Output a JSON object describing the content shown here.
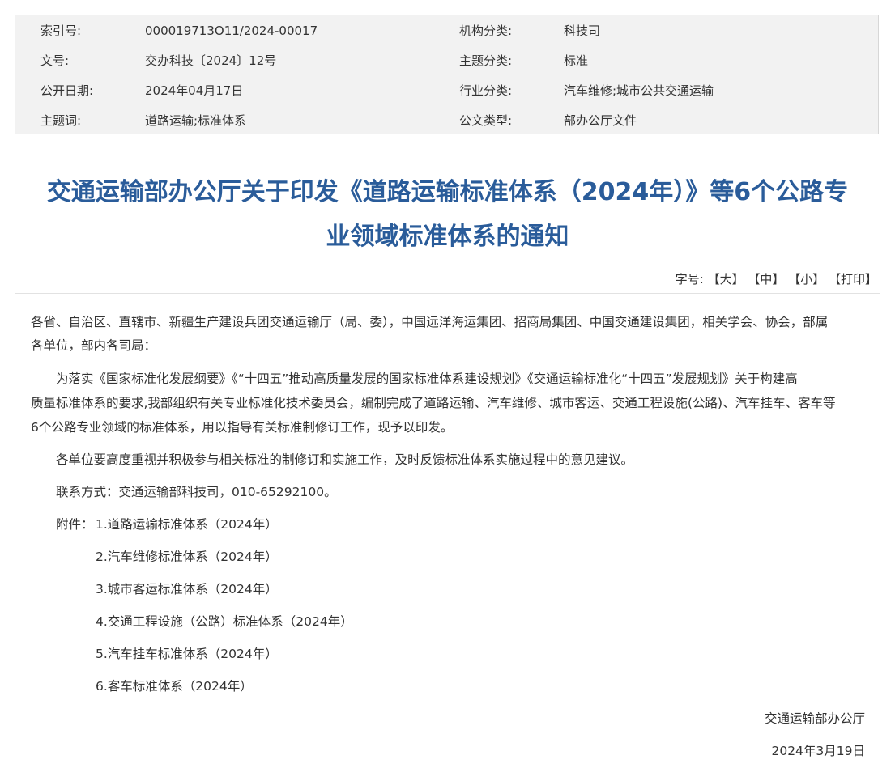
{
  "meta": {
    "index_label": "索引号:",
    "index_value": "000019713O11/2024-00017",
    "org_label": "机构分类:",
    "org_value": "科技司",
    "doc_label": "文号:",
    "doc_value": "交办科技〔2024〕12号",
    "topic_cat_label": "主题分类:",
    "topic_cat_value": "标准",
    "date_label": "公开日期:",
    "date_value": "2024年04月17日",
    "industry_label": "行业分类:",
    "industry_value": "汽车维修;城市公共交通运输",
    "keywords_label": "主题词:",
    "keywords_value": "道路运输;标准体系",
    "doctype_label": "公文类型:",
    "doctype_value": "部办公厅文件"
  },
  "title": {
    "line1": "交通运输部办公厅关于印发《道路运输标准体系（2024年）》等6个公路专",
    "line2": "业领域标准体系的通知"
  },
  "fontsize": {
    "label": "字号:",
    "large": "【大】",
    "medium": "【中】",
    "small": "【小】",
    "print": "【打印】"
  },
  "body": {
    "addressee1": "各省、自治区、直辖市、新疆生产建设兵团交通运输厅（局、委），中国远洋海运集团、招商局集团、中国交通建设集团，相关学会、协会，部属",
    "addressee2": "各单位，部内各司局：",
    "p1_l1": "为落实《国家标准化发展纲要》《“十四五”推动高质量发展的国家标准体系建设规划》《交通运输标准化“十四五”发展规划》关于构建高",
    "p1_l2": "质量标准体系的要求,我部组织有关专业标准化技术委员会，编制完成了道路运输、汽车维修、城市客运、交通工程设施(公路)、汽车挂车、客车等",
    "p1_l3": "6个公路专业领域的标准体系，用以指导有关标准制修订工作，现予以印发。",
    "p2": "各单位要高度重视并积极参与相关标准的制修订和实施工作，及时反馈标准体系实施过程中的意见建议。",
    "contact": "联系方式：交通运输部科技司，010-65292100。",
    "attachments_label": "附件：",
    "attachments": [
      "1.道路运输标准体系（2024年）",
      "2.汽车维修标准体系（2024年）",
      "3.城市客运标准体系（2024年）",
      "4.交通工程设施（公路）标准体系（2024年）",
      "5.汽车挂车标准体系（2024年）",
      "6.客车标准体系（2024年）"
    ],
    "signature": "交通运输部办公厅",
    "sign_date": "2024年3月19日"
  }
}
